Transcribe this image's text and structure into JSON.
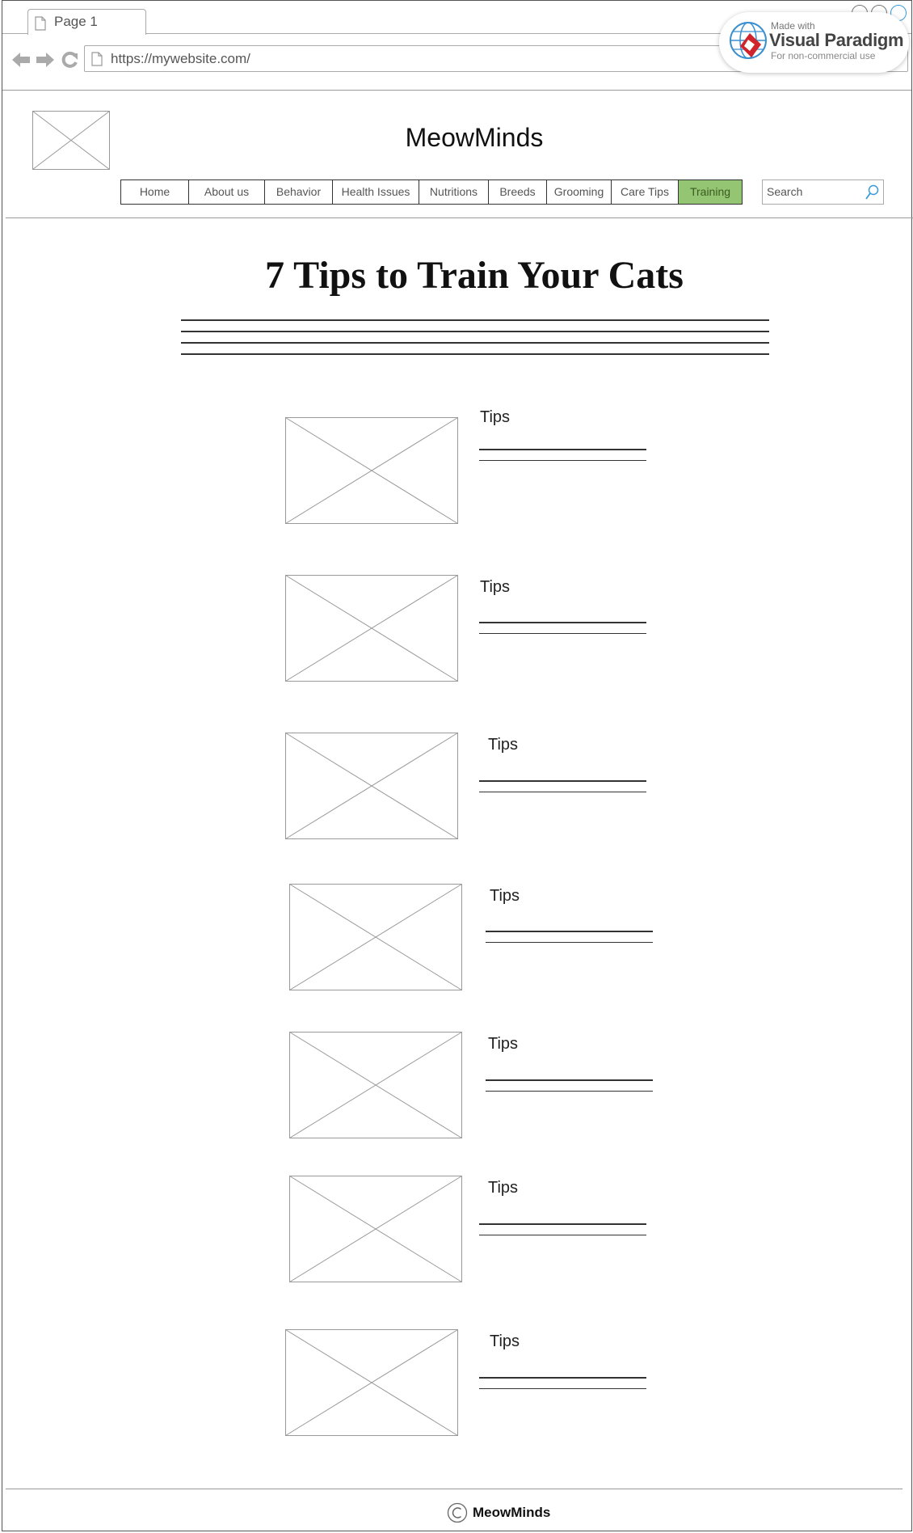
{
  "browser": {
    "tab_label": "Page 1",
    "url": "https://mywebsite.com/"
  },
  "watermark": {
    "top": "Made with",
    "brand": "Visual Paradigm",
    "sub": "For non-commercial use"
  },
  "header": {
    "site_title": "MeowMinds",
    "nav_items": [
      {
        "label": "Home",
        "active": false
      },
      {
        "label": "About us",
        "active": false
      },
      {
        "label": "Behavior",
        "active": false
      },
      {
        "label": "Health Issues",
        "active": false
      },
      {
        "label": "Nutritions",
        "active": false
      },
      {
        "label": "Breeds",
        "active": false
      },
      {
        "label": "Grooming",
        "active": false
      },
      {
        "label": "Care Tips",
        "active": false
      },
      {
        "label": "Training",
        "active": true
      }
    ],
    "search_placeholder": "Search"
  },
  "main": {
    "heading": "7 Tips to Train Your Cats",
    "tips": [
      {
        "label": "Tips"
      },
      {
        "label": "Tips"
      },
      {
        "label": "Tips"
      },
      {
        "label": "Tips"
      },
      {
        "label": "Tips"
      },
      {
        "label": "Tips"
      },
      {
        "label": "Tips"
      }
    ]
  },
  "footer": {
    "text": "MeowMinds"
  },
  "colors": {
    "active_nav": "#93c572",
    "border": "#333333",
    "placeholder_lines": "#999999"
  }
}
